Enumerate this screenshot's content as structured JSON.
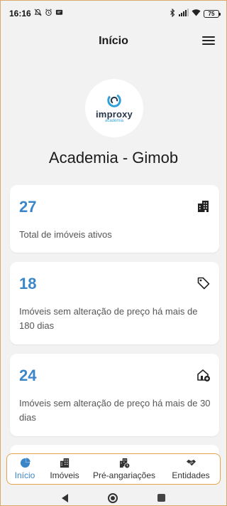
{
  "status_bar": {
    "time": "16:16",
    "battery": "75",
    "left_icons": [
      "mute-notification-icon",
      "alarm-icon",
      "message-icon"
    ],
    "right_icons": [
      "bluetooth-icon",
      "signal-icon",
      "wifi-icon",
      "battery-icon"
    ]
  },
  "header": {
    "title": "Início",
    "menu_icon": "hamburger-menu-icon"
  },
  "logo": {
    "name": "improxy",
    "sub": "academia",
    "colors": {
      "ring": "#2f9fd8",
      "text": "#27344a",
      "sub": "#3aa3d8"
    }
  },
  "organization": {
    "name": "Academia - Gimob"
  },
  "cards": [
    {
      "value": "27",
      "label": "Total de imóveis ativos",
      "icon": "buildings-icon"
    },
    {
      "value": "18",
      "label": "Imóveis sem alteração de preço há mais de 180 dias",
      "icon": "price-tag-icon"
    },
    {
      "value": "24",
      "label": "Imóveis sem alteração de preço há mais de 30 dias",
      "icon": "house-add-icon"
    }
  ],
  "bottom_nav": {
    "items": [
      {
        "label": "Início",
        "icon": "pie-chart-icon",
        "active": true
      },
      {
        "label": "Imóveis",
        "icon": "buildings-icon",
        "active": false
      },
      {
        "label": "Pré-angariações",
        "icon": "building-clock-icon",
        "active": false
      },
      {
        "label": "Entidades",
        "icon": "handshake-icon",
        "active": false
      }
    ]
  },
  "system_nav": {
    "items": [
      "back-icon",
      "home-icon",
      "recents-icon"
    ]
  },
  "colors": {
    "accent": "#3a86c8",
    "background": "#f2f2f2",
    "nav_border": "#e5a24a"
  }
}
